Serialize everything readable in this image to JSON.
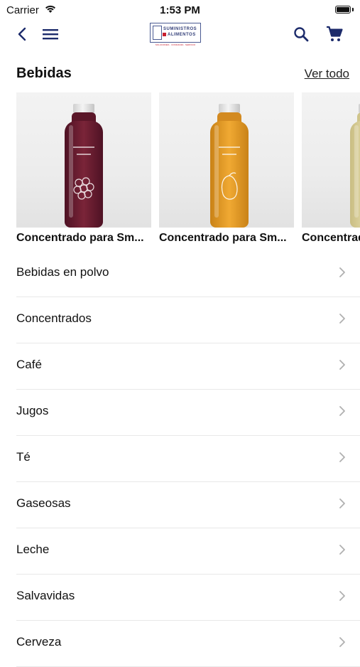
{
  "status": {
    "carrier": "Carrier",
    "time": "1:53 PM"
  },
  "nav": {
    "logo_line1": "SUMINISTROS",
    "logo_line2": "ALIMENTOS",
    "logo_tagline": "SOLUCIONES · CONFIANZA · SERVICIO"
  },
  "section": {
    "title": "Bebidas",
    "see_all": "Ver todo"
  },
  "products": [
    {
      "name": "Concentrado para Smoothie Mora",
      "display": "Concentrado para Sm...",
      "color": "#6e1f33"
    },
    {
      "name": "Concentrado para Smoothie Mango",
      "display": "Concentrado para Sm...",
      "color": "#e19a2a"
    },
    {
      "name": "Concentrado",
      "display": "Concentrado para Sm...",
      "color": "#d9cf9a"
    }
  ],
  "categories": [
    {
      "label": "Bebidas en polvo"
    },
    {
      "label": "Concentrados"
    },
    {
      "label": "Café"
    },
    {
      "label": "Jugos"
    },
    {
      "label": "Té"
    },
    {
      "label": "Gaseosas"
    },
    {
      "label": "Leche"
    },
    {
      "label": "Salvavidas"
    },
    {
      "label": "Cerveza"
    }
  ],
  "colors": {
    "accent": "#1c2b6b",
    "logo_red": "#c8202f"
  }
}
